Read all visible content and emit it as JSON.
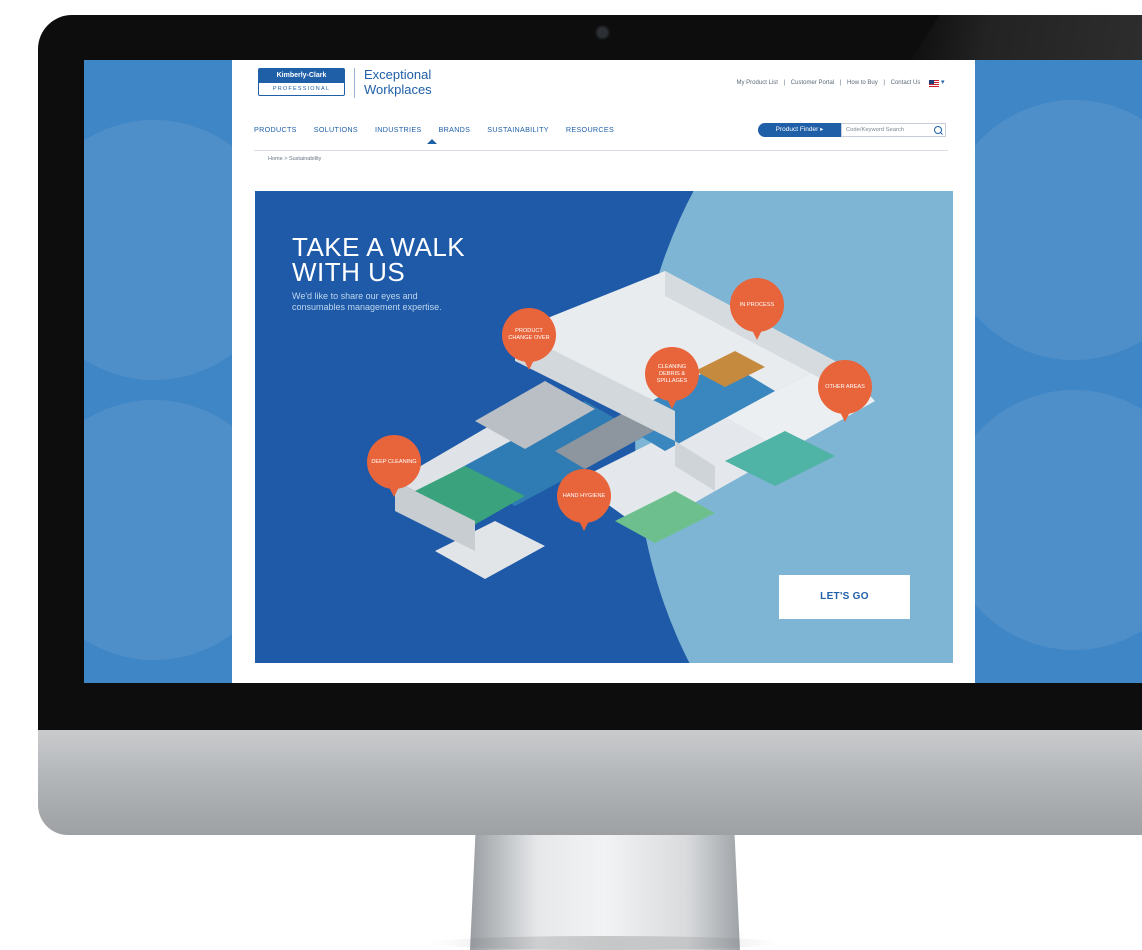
{
  "header": {
    "logo_top": "Kimberly-Clark",
    "logo_bottom": "PROFESSIONAL",
    "tagline_line1": "Exceptional",
    "tagline_line2": "Workplaces"
  },
  "utility_nav": {
    "items": [
      "My Product List",
      "Customer Portal",
      "How to Buy",
      "Contact Us"
    ],
    "separator": "|"
  },
  "main_nav": {
    "items": [
      "PRODUCTS",
      "SOLUTIONS",
      "INDUSTRIES",
      "BRANDS",
      "SUSTAINABILITY",
      "RESOURCES"
    ],
    "active": "INDUSTRIES"
  },
  "product_finder": {
    "label": "Product Finder"
  },
  "search": {
    "placeholder": "Code/Keyword Search"
  },
  "breadcrumb": {
    "text": "Home > Sustainability"
  },
  "hero": {
    "title_line1": "TAKE A WALK",
    "title_line2": "WITH US",
    "subtitle": "We'd like to share our eyes and consumables management expertise.",
    "cta": "LET'S GO",
    "pins": [
      {
        "label": "PRODUCT CHANGE OVER"
      },
      {
        "label": "IN PROCESS"
      },
      {
        "label": "CLEANING DEBRIS & SPILLAGES"
      },
      {
        "label": "OTHER AREAS"
      },
      {
        "label": "DEEP CLEANING"
      },
      {
        "label": "HAND HYGIENE"
      }
    ]
  },
  "colors": {
    "brand_blue": "#1f5fa8",
    "hero_dark": "#1e5aa8",
    "hero_light": "#7fb5d4",
    "pin_orange": "#e8643b",
    "desktop_bg": "#3f86c6"
  }
}
